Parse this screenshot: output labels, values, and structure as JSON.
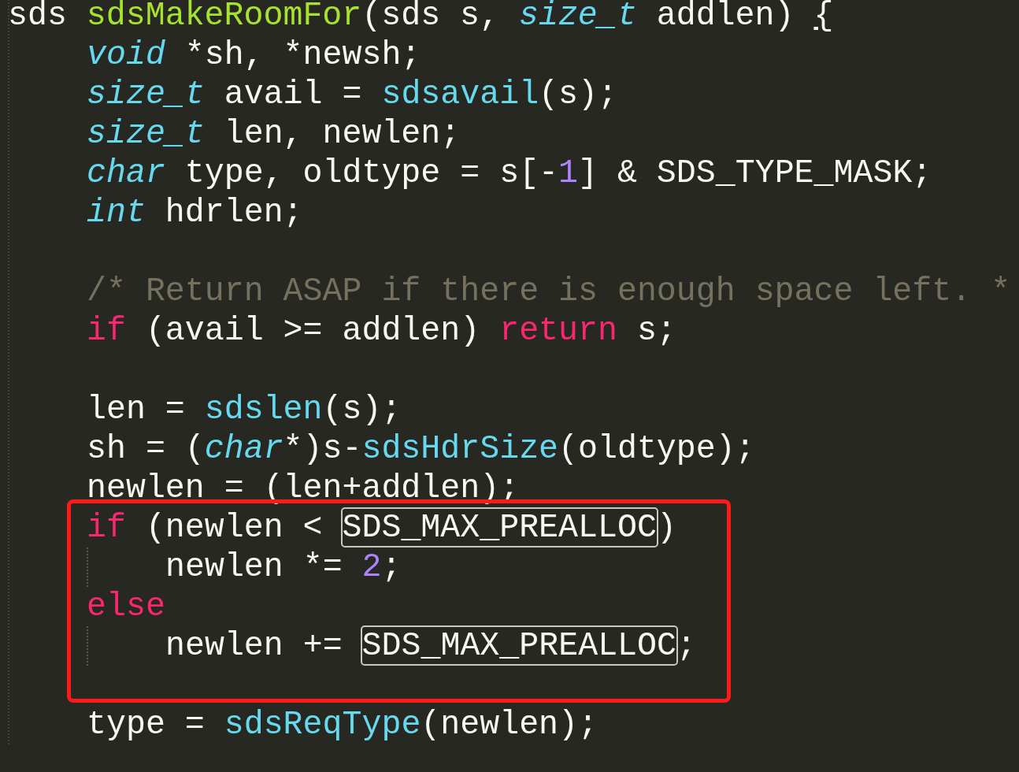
{
  "lines": [
    {
      "kind": "code",
      "indented": false,
      "guide": false,
      "tokens": [
        {
          "text": "sds ",
          "kind": "plain"
        },
        {
          "text": "sdsMakeRoomFor",
          "kind": "function"
        },
        {
          "text": "(sds s, ",
          "kind": "plain"
        },
        {
          "text": "size_t",
          "kind": "type"
        },
        {
          "text": " addlen) ",
          "kind": "plain"
        },
        {
          "text": "{",
          "kind": "bracket-match"
        }
      ]
    },
    {
      "kind": "code",
      "indented": true,
      "guide": false,
      "tokens": [
        {
          "text": "void",
          "kind": "type"
        },
        {
          "text": " *sh, *newsh;",
          "kind": "plain"
        }
      ]
    },
    {
      "kind": "code",
      "indented": true,
      "guide": false,
      "tokens": [
        {
          "text": "size_t",
          "kind": "type"
        },
        {
          "text": " avail = ",
          "kind": "plain"
        },
        {
          "text": "sdsavail",
          "kind": "call"
        },
        {
          "text": "(s);",
          "kind": "plain"
        }
      ]
    },
    {
      "kind": "code",
      "indented": true,
      "guide": false,
      "tokens": [
        {
          "text": "size_t",
          "kind": "type"
        },
        {
          "text": " len, newlen;",
          "kind": "plain"
        }
      ]
    },
    {
      "kind": "code",
      "indented": true,
      "guide": false,
      "tokens": [
        {
          "text": "char",
          "kind": "type"
        },
        {
          "text": " type, oldtype = s[-",
          "kind": "plain"
        },
        {
          "text": "1",
          "kind": "number"
        },
        {
          "text": "] & SDS_TYPE_MASK;",
          "kind": "plain"
        }
      ]
    },
    {
      "kind": "code",
      "indented": true,
      "guide": false,
      "tokens": [
        {
          "text": "int",
          "kind": "type"
        },
        {
          "text": " hdrlen;",
          "kind": "plain"
        }
      ]
    },
    {
      "kind": "blank"
    },
    {
      "kind": "code",
      "indented": true,
      "guide": false,
      "tokens": [
        {
          "text": "/* Return ASAP if there is enough space left. *",
          "kind": "comment"
        }
      ]
    },
    {
      "kind": "code",
      "indented": true,
      "guide": false,
      "tokens": [
        {
          "text": "if",
          "kind": "keyword"
        },
        {
          "text": " (avail >= addlen) ",
          "kind": "plain"
        },
        {
          "text": "return",
          "kind": "keyword"
        },
        {
          "text": " s;",
          "kind": "plain"
        }
      ]
    },
    {
      "kind": "blank"
    },
    {
      "kind": "code",
      "indented": true,
      "guide": false,
      "tokens": [
        {
          "text": "len = ",
          "kind": "plain"
        },
        {
          "text": "sdslen",
          "kind": "call"
        },
        {
          "text": "(s);",
          "kind": "plain"
        }
      ]
    },
    {
      "kind": "code",
      "indented": true,
      "guide": false,
      "tokens": [
        {
          "text": "sh = (",
          "kind": "plain"
        },
        {
          "text": "char",
          "kind": "type"
        },
        {
          "text": "*)s-",
          "kind": "plain"
        },
        {
          "text": "sdsHdrSize",
          "kind": "call"
        },
        {
          "text": "(oldtype);",
          "kind": "plain"
        }
      ]
    },
    {
      "kind": "code",
      "indented": true,
      "guide": false,
      "tokens": [
        {
          "text": "newlen = (len+addlen);",
          "kind": "plain"
        }
      ]
    },
    {
      "kind": "code",
      "indented": true,
      "guide": false,
      "tokens": [
        {
          "text": "if",
          "kind": "keyword"
        },
        {
          "text": " (newlen < ",
          "kind": "plain"
        },
        {
          "text": "SDS_MAX_PREALLOC",
          "kind": "match"
        },
        {
          "text": ")",
          "kind": "plain"
        }
      ]
    },
    {
      "kind": "code",
      "indented": true,
      "guide": true,
      "tokens": [
        {
          "text": "newlen *= ",
          "kind": "plain"
        },
        {
          "text": "2",
          "kind": "number"
        },
        {
          "text": ";",
          "kind": "plain"
        }
      ]
    },
    {
      "kind": "code",
      "indented": true,
      "guide": false,
      "tokens": [
        {
          "text": "else",
          "kind": "keyword"
        }
      ]
    },
    {
      "kind": "code",
      "indented": true,
      "guide": true,
      "tokens": [
        {
          "text": "newlen += ",
          "kind": "plain"
        },
        {
          "text": "SDS_MAX_PREALLOC",
          "kind": "match"
        },
        {
          "text": ";",
          "kind": "plain"
        }
      ]
    },
    {
      "kind": "blank"
    },
    {
      "kind": "code",
      "indented": true,
      "guide": false,
      "tokens": [
        {
          "text": "type = ",
          "kind": "plain"
        },
        {
          "text": "sdsReqType",
          "kind": "call"
        },
        {
          "text": "(newlen);",
          "kind": "plain"
        }
      ]
    }
  ]
}
